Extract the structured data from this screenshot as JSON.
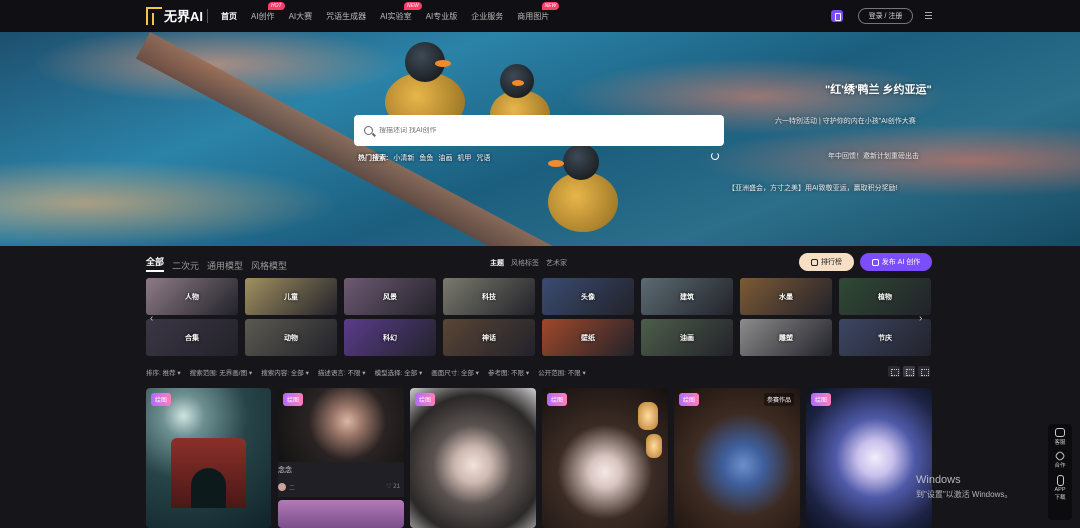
{
  "brand": {
    "logo_text": "无界AI"
  },
  "nav": {
    "items": [
      {
        "label": "首页",
        "badge": ""
      },
      {
        "label": "AI创作",
        "badge": "HOT"
      },
      {
        "label": "AI大赛",
        "badge": ""
      },
      {
        "label": "咒语生成器",
        "badge": ""
      },
      {
        "label": "AI实验室",
        "badge": "NEW"
      },
      {
        "label": "AI专业版",
        "badge": ""
      },
      {
        "label": "企业服务",
        "badge": ""
      },
      {
        "label": "商用图片",
        "badge": "NEW"
      }
    ],
    "login_label": "登录 / 注册"
  },
  "banner": {
    "headline": "\"红'绣'鸭兰 乡约亚运\"",
    "line2": "六一特别活动 | 守护你的内在小孩\"AI创作大赛",
    "line3": "年中回馈！邀新计划重磅出击",
    "line4": "【亚洲盛会，方寸之美】用AI致敬亚运，赢取积分奖励!"
  },
  "search": {
    "placeholder": "搜描述词 找AI创作",
    "hot_label": "热门搜索:",
    "hot_terms": [
      "小清新",
      "鱼鱼",
      "油画",
      "机甲",
      "咒语"
    ]
  },
  "tabs": [
    "全部",
    "二次元",
    "通用模型",
    "风格模型"
  ],
  "style_tabs": [
    "主题",
    "风格标签",
    "艺术家"
  ],
  "buttons": {
    "rank": "排行榜",
    "publish": "发布 AI 创作"
  },
  "categories": [
    {
      "label": "人物",
      "color": "#8d7b86"
    },
    {
      "label": "儿童",
      "color": "#a19060"
    },
    {
      "label": "风景",
      "color": "#6e5a72"
    },
    {
      "label": "科技",
      "color": "#7a7a6c"
    },
    {
      "label": "头像",
      "color": "#3a4c72"
    },
    {
      "label": "建筑",
      "color": "#5b6c72"
    },
    {
      "label": "水墨",
      "color": "#7d5a35"
    },
    {
      "label": "植物",
      "color": "#2f4a33"
    },
    {
      "label": "合集",
      "color": "#3c3644"
    },
    {
      "label": "动物",
      "color": "#5b5a50"
    },
    {
      "label": "科幻",
      "color": "#5a3c8c"
    },
    {
      "label": "神话",
      "color": "#5a4535"
    },
    {
      "label": "壁纸",
      "color": "#a0482a"
    },
    {
      "label": "油画",
      "color": "#4d5e4a"
    },
    {
      "label": "雕塑",
      "color": "#8c8c8c"
    },
    {
      "label": "节庆",
      "color": "#3c4663"
    }
  ],
  "filters": [
    "排序: 推荐 ▾",
    "搜索范围: 无界画/图 ▾",
    "搜索内容: 全部 ▾",
    "描述语言: 不限 ▾",
    "模型选择: 全部 ▾",
    "画面尺寸: 全部 ▾",
    "参考图: 不限 ▾",
    "公开范围: 不限 ▾"
  ],
  "cards": [
    {
      "tag": "绘图",
      "contest": ""
    },
    {
      "tag": "绘图",
      "contest": "",
      "title": "念念",
      "author": "二",
      "likes": "♡ 21"
    },
    {
      "tag": "绘图",
      "contest": ""
    },
    {
      "tag": "绘图",
      "contest": ""
    },
    {
      "tag": "绘图",
      "contest": "参赛作品"
    },
    {
      "tag": "绘图",
      "contest": ""
    }
  ],
  "side_tools": [
    "客服",
    "合作",
    "APP下载"
  ],
  "watermark": {
    "line1": "Windows",
    "line2": "到\"设置\"以激活 Windows。"
  }
}
